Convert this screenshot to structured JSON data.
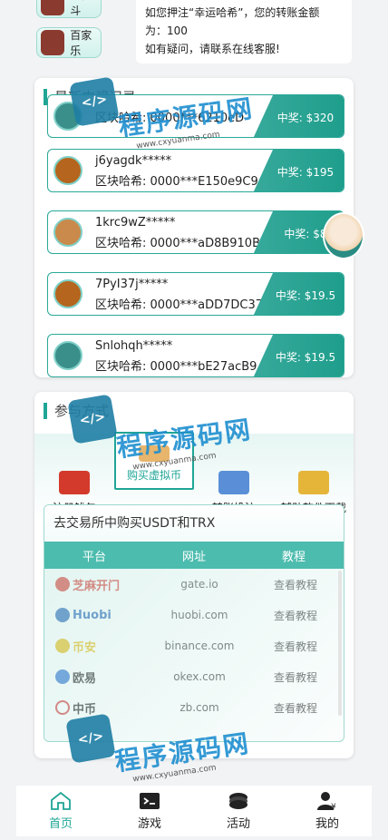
{
  "games": [
    {
      "label": "龙虎斗",
      "icon": "dragon-tiger-icon"
    },
    {
      "label": "百家乐",
      "icon": "baccarat-icon"
    }
  ],
  "notice": {
    "line1": "如您押注“幸运哈希”，您的转账金额",
    "line2": "为：100",
    "line3": "如有疑问，请联系在线客服!"
  },
  "records": {
    "title": "最新中奖记录",
    "items": [
      {
        "name": "",
        "hash": "区块哈希: 0000***6210eD",
        "prize": "中奖: $320"
      },
      {
        "name": "j6yagdk*****",
        "hash": "区块哈希: 0000***E150e9C9",
        "prize": "中奖: $195"
      },
      {
        "name": "1krc9wZ*****",
        "hash": "区块哈希: 0000***aD8B910B",
        "prize": "中奖: $8"
      },
      {
        "name": "7PyI37j*****",
        "hash": "区块哈希: 0000***aDD7DC37",
        "prize": "中奖: $19.5"
      },
      {
        "name": "Snlohqh*****",
        "hash": "区块哈希: 0000***bE27acB9",
        "prize": "中奖: $19.5"
      }
    ]
  },
  "participate": {
    "title": "参与方式",
    "tabs": [
      {
        "label": "注册钱包",
        "icon": "wallet-icon",
        "color": "#d33a2c"
      },
      {
        "label": "购买虚拟币",
        "icon": "buy-coin-icon",
        "color": "#e8b56d"
      },
      {
        "label": "转账投注",
        "icon": "transfer-icon",
        "color": "#5a8fd8"
      },
      {
        "label": "辅助软件下载",
        "icon": "trophy-icon",
        "color": "#e5b53a"
      }
    ]
  },
  "exchange": {
    "title": "去交易所中购买USDT和TRX",
    "headers": [
      "平台",
      "网址",
      "教程"
    ],
    "rows": [
      {
        "logo": "芝麻开门",
        "logo_color": "#d9342b",
        "url": "gate.io",
        "tutorial": "查看教程"
      },
      {
        "logo": "Huobi",
        "logo_color": "#1e5fb4",
        "url": "huobi.com",
        "tutorial": "查看教程"
      },
      {
        "logo": "币安",
        "logo_color": "#e5b80b",
        "url": "binance.com",
        "tutorial": "查看教程"
      },
      {
        "logo": "欧易",
        "logo_color": "#2b6fd1",
        "url": "okex.com",
        "tutorial": "查看教程"
      },
      {
        "logo": "中币",
        "logo_color": "#d33a3a",
        "url": "zb.com",
        "tutorial": "查看教程"
      }
    ]
  },
  "nav": [
    {
      "label": "首页",
      "icon": "home-icon"
    },
    {
      "label": "游戏",
      "icon": "game-icon"
    },
    {
      "label": "活动",
      "icon": "activity-icon"
    },
    {
      "label": "我的",
      "icon": "user-icon"
    }
  ],
  "watermark": {
    "text": "程序源码网",
    "url": "www.cxyuanma.com"
  },
  "colors": {
    "accent": "#1fa596",
    "prize_bg": "#2aa898"
  }
}
